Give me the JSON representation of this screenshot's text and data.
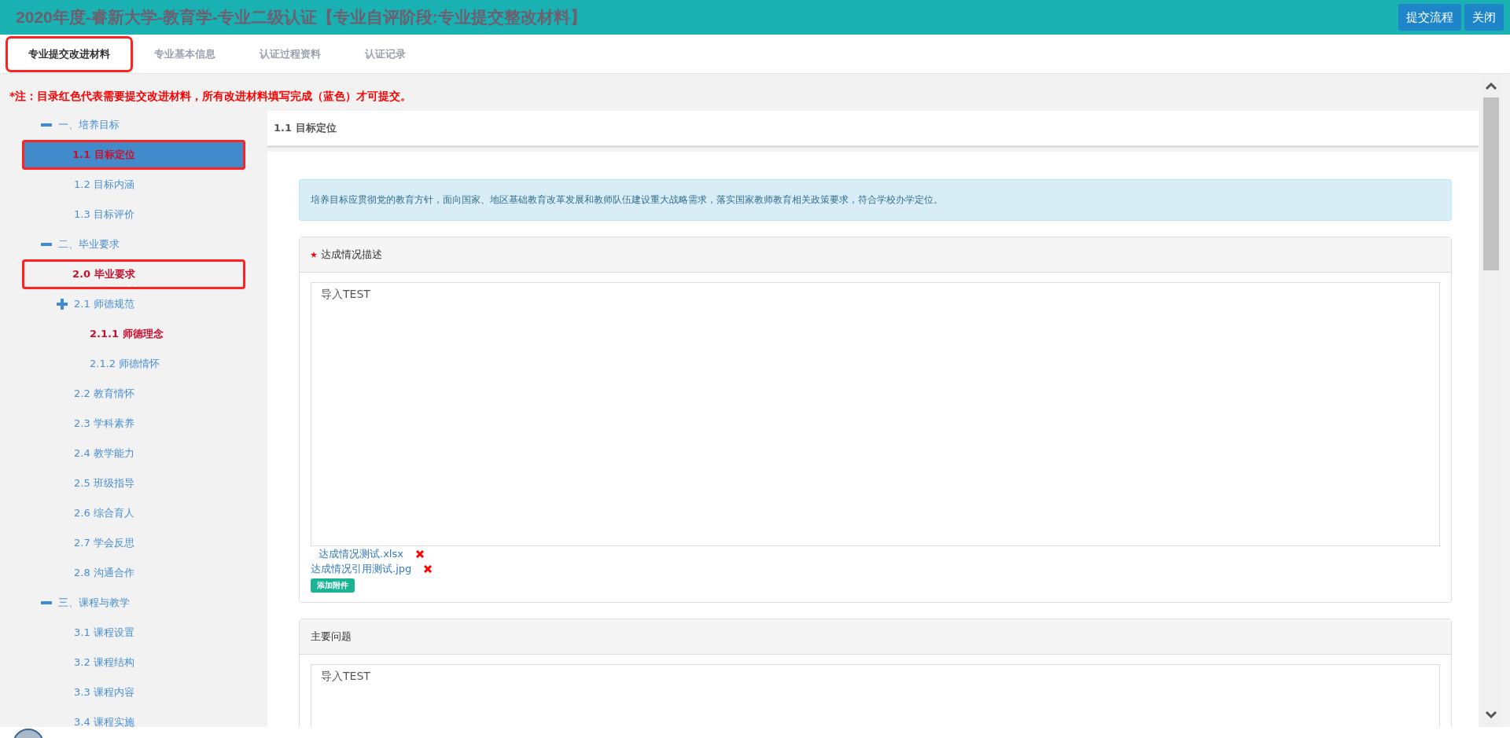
{
  "header": {
    "title": "2020年度-睿新大学-教育学-专业二级认证【专业自评阶段:专业提交整改材料】",
    "buttons": [
      "提交流程",
      "关闭"
    ]
  },
  "tabs": [
    {
      "label": "专业提交改进材料",
      "selected": true,
      "annotated": true
    },
    {
      "label": "专业基本信息",
      "selected": false,
      "annotated": false
    },
    {
      "label": "认证过程资料",
      "selected": false,
      "annotated": false
    },
    {
      "label": "认证记录",
      "selected": false,
      "annotated": false
    }
  ],
  "notice": "*注：目录红色代表需要提交改进材料，所有改进材料填写完成（蓝色）才可提交。",
  "tree": [
    {
      "label": "一、培养目标",
      "kind": "group",
      "expanded": true,
      "required": false,
      "selected": false,
      "annotated": false,
      "children": [
        {
          "label": "1.1 目标定位",
          "kind": "item",
          "required": true,
          "selected": true,
          "annotated": true
        },
        {
          "label": "1.2 目标内涵",
          "kind": "item",
          "required": false,
          "selected": false,
          "annotated": false
        },
        {
          "label": "1.3 目标评价",
          "kind": "item",
          "required": false,
          "selected": false,
          "annotated": false
        }
      ]
    },
    {
      "label": "二、毕业要求",
      "kind": "group",
      "expanded": true,
      "required": false,
      "selected": false,
      "annotated": false,
      "children": [
        {
          "label": "2.0 毕业要求",
          "kind": "item",
          "required": true,
          "selected": false,
          "annotated": true
        },
        {
          "label": "2.1 师德规范",
          "kind": "group",
          "expanded": false,
          "required": false,
          "selected": false,
          "annotated": false,
          "children": [
            {
              "label": "2.1.1 师德理念",
              "kind": "item",
              "required": true,
              "selected": false,
              "annotated": false
            },
            {
              "label": "2.1.2 师德情怀",
              "kind": "item",
              "required": false,
              "selected": false,
              "annotated": false
            }
          ]
        },
        {
          "label": "2.2 教育情怀",
          "kind": "item",
          "required": false,
          "selected": false,
          "annotated": false
        },
        {
          "label": "2.3 学科素养",
          "kind": "item",
          "required": false,
          "selected": false,
          "annotated": false
        },
        {
          "label": "2.4 教学能力",
          "kind": "item",
          "required": false,
          "selected": false,
          "annotated": false
        },
        {
          "label": "2.5 班级指导",
          "kind": "item",
          "required": false,
          "selected": false,
          "annotated": false
        },
        {
          "label": "2.6 综合育人",
          "kind": "item",
          "required": false,
          "selected": false,
          "annotated": false
        },
        {
          "label": "2.7 学会反思",
          "kind": "item",
          "required": false,
          "selected": false,
          "annotated": false
        },
        {
          "label": "2.8 沟通合作",
          "kind": "item",
          "required": false,
          "selected": false,
          "annotated": false
        }
      ]
    },
    {
      "label": "三、课程与教学",
      "kind": "group",
      "expanded": true,
      "required": false,
      "selected": false,
      "annotated": false,
      "children": [
        {
          "label": "3.1 课程设置",
          "kind": "item",
          "required": false,
          "selected": false,
          "annotated": false
        },
        {
          "label": "3.2 课程结构",
          "kind": "item",
          "required": false,
          "selected": false,
          "annotated": false
        },
        {
          "label": "3.3 课程内容",
          "kind": "item",
          "required": false,
          "selected": false,
          "annotated": false
        },
        {
          "label": "3.4 课程实施",
          "kind": "item",
          "required": false,
          "selected": false,
          "annotated": false
        }
      ]
    }
  ],
  "content": {
    "title": "1.1 目标定位",
    "info": "培养目标应贯彻党的教育方针，面向国家、地区基础教育改革发展和教师队伍建设重大战略需求，落实国家教师教育相关政策要求，符合学校办学定位。",
    "panels": [
      {
        "title": "达成情况描述",
        "required": true,
        "value": "导入TEST",
        "attachments": [
          "达成情况测试.xlsx",
          "达成情况引用测试.jpg"
        ],
        "add_button": "添加附件"
      },
      {
        "title": "主要问题",
        "required": false,
        "value": "导入TEST"
      }
    ]
  }
}
